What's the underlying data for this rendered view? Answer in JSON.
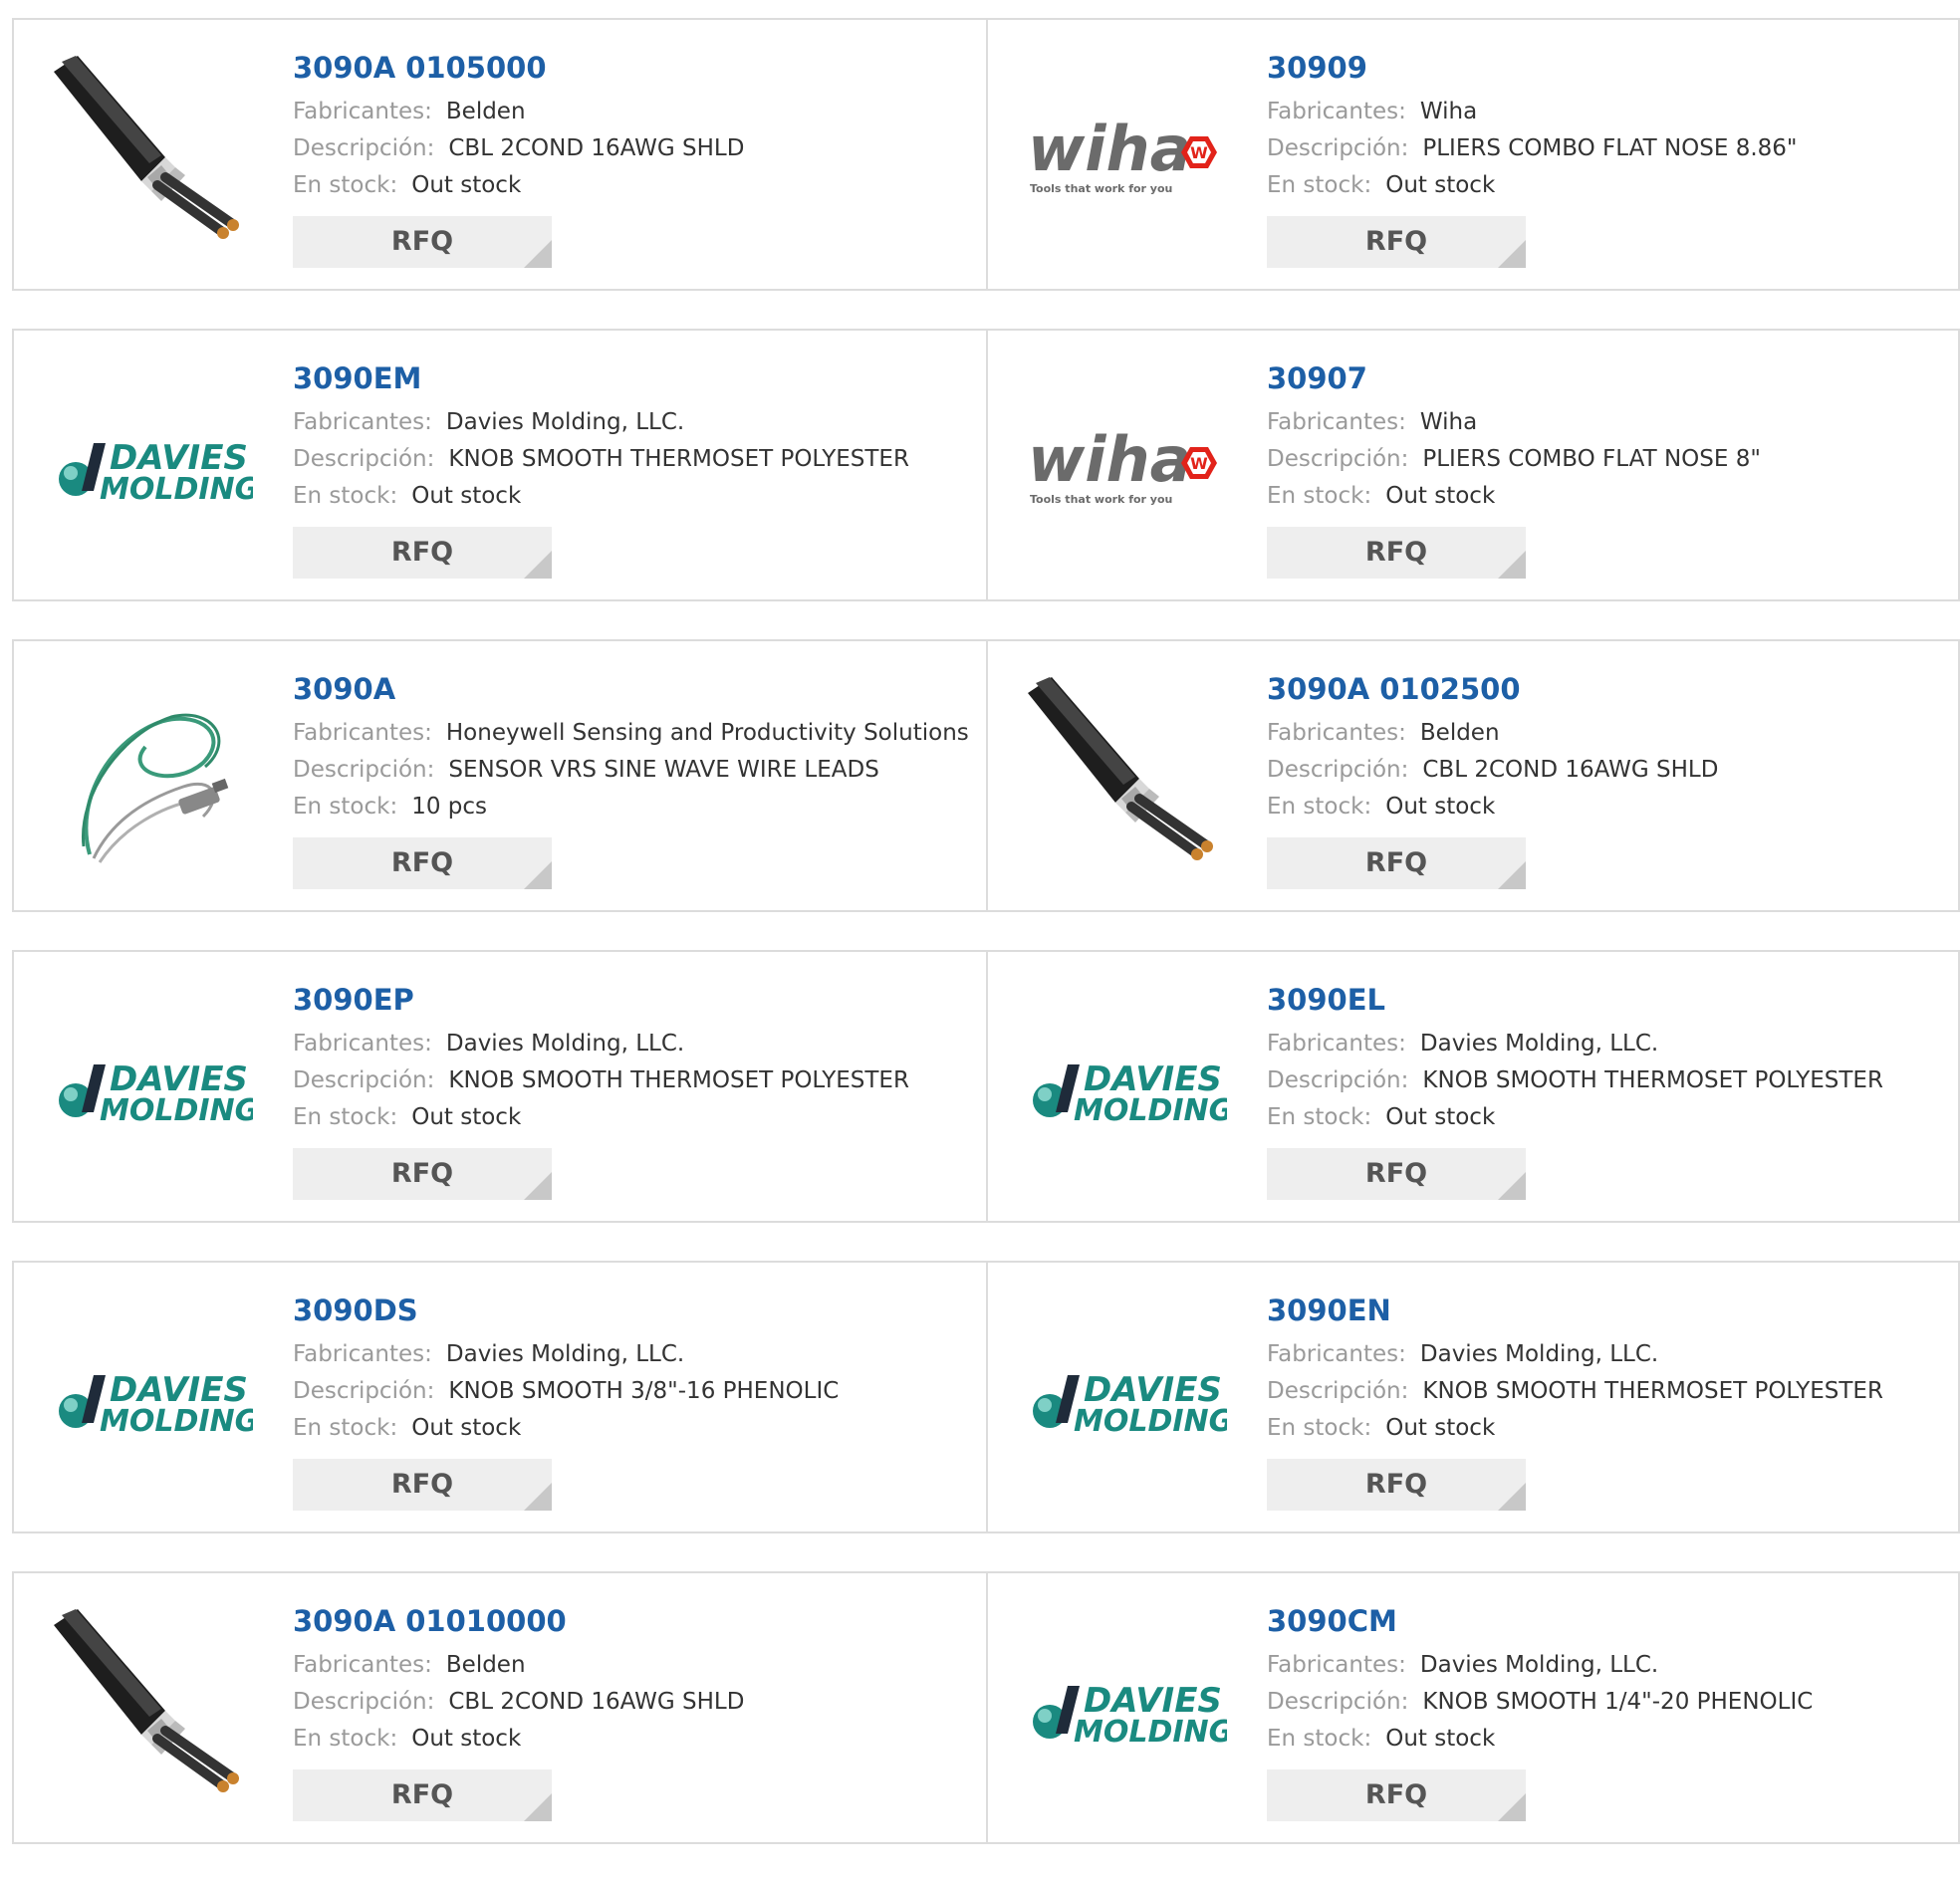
{
  "labels": {
    "manufacturer": "Fabricantes:",
    "description": "Descripción:",
    "stock": "En stock:",
    "rfq": "RFQ"
  },
  "brand_text": {
    "wiha": "wiha",
    "wiha_badge": "W",
    "wiha_tagline": "Tools that work for you",
    "davies_line1": "DAVIES",
    "davies_line2": "MOLDING"
  },
  "colors": {
    "part_link": "#1d5fa6",
    "label": "#9a9a9a",
    "value": "#333333",
    "rfq_bg": "#eeeeee",
    "border": "#dcdcdc",
    "wiha_red": "#e2231a",
    "davies_teal": "#1a8a80"
  },
  "products": [
    {
      "part": "3090A 0105000",
      "manufacturer": "Belden",
      "description": "CBL 2COND 16AWG SHLD",
      "stock": "Out stock",
      "image": "cable-image"
    },
    {
      "part": "30909",
      "manufacturer": "Wiha",
      "description": "PLIERS COMBO FLAT NOSE 8.86\"",
      "stock": "Out stock",
      "image": "wiha-logo"
    },
    {
      "part": "3090EM",
      "manufacturer": "Davies Molding, LLC.",
      "description": "KNOB SMOOTH THERMOSET POLYESTER",
      "stock": "Out stock",
      "image": "davies-molding-logo"
    },
    {
      "part": "30907",
      "manufacturer": "Wiha",
      "description": "PLIERS COMBO FLAT NOSE 8\"",
      "stock": "Out stock",
      "image": "wiha-logo"
    },
    {
      "part": "3090A",
      "manufacturer": "Honeywell Sensing and Productivity Solutions",
      "description": "SENSOR VRS SINE WAVE WIRE LEADS",
      "stock": "10 pcs",
      "image": "sensor-image"
    },
    {
      "part": "3090A 0102500",
      "manufacturer": "Belden",
      "description": "CBL 2COND 16AWG SHLD",
      "stock": "Out stock",
      "image": "cable-image"
    },
    {
      "part": "3090EP",
      "manufacturer": "Davies Molding, LLC.",
      "description": "KNOB SMOOTH THERMOSET POLYESTER",
      "stock": "Out stock",
      "image": "davies-molding-logo"
    },
    {
      "part": "3090EL",
      "manufacturer": "Davies Molding, LLC.",
      "description": "KNOB SMOOTH THERMOSET POLYESTER",
      "stock": "Out stock",
      "image": "davies-molding-logo"
    },
    {
      "part": "3090DS",
      "manufacturer": "Davies Molding, LLC.",
      "description": "KNOB SMOOTH 3/8\"-16 PHENOLIC",
      "stock": "Out stock",
      "image": "davies-molding-logo"
    },
    {
      "part": "3090EN",
      "manufacturer": "Davies Molding, LLC.",
      "description": "KNOB SMOOTH THERMOSET POLYESTER",
      "stock": "Out stock",
      "image": "davies-molding-logo"
    },
    {
      "part": "3090A 01010000",
      "manufacturer": "Belden",
      "description": "CBL 2COND 16AWG SHLD",
      "stock": "Out stock",
      "image": "cable-image"
    },
    {
      "part": "3090CM",
      "manufacturer": "Davies Molding, LLC.",
      "description": "KNOB SMOOTH 1/4\"-20 PHENOLIC",
      "stock": "Out stock",
      "image": "davies-molding-logo"
    }
  ]
}
